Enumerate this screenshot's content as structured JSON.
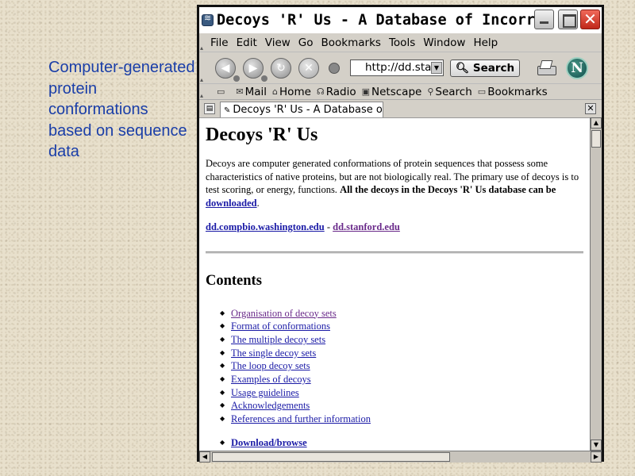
{
  "caption": "Computer-generated protein conformations based on sequence data",
  "window": {
    "title": "Decoys 'R' Us - A Database of Incorrect Pr…",
    "close_symbol": "✕"
  },
  "menubar": [
    "File",
    "Edit",
    "View",
    "Go",
    "Bookmarks",
    "Tools",
    "Window",
    "Help"
  ],
  "navbar": {
    "url": "http://dd.stan",
    "search_label": "Search"
  },
  "personal_toolbar": [
    "Mail",
    "Home",
    "Radio",
    "Netscape",
    "Search",
    "Bookmarks"
  ],
  "tab": {
    "label": "Decoys 'R' Us - A Database o…"
  },
  "page": {
    "heading": "Decoys 'R' Us",
    "intro": "Decoys are computer generated conformations of protein sequences that possess some characteristics of native proteins, but are not biologically real. The primary use of decoys is to test scoring, or energy, functions.",
    "intro_bold": "All the decoys in the Decoys 'R' Us database can be",
    "download_link": "downloaded",
    "period": ".",
    "mirror_1": "dd.compbio.washington.edu",
    "mirror_sep": " - ",
    "mirror_2": "dd.stanford.edu",
    "contents_heading": "Contents",
    "contents": [
      "Organisation of decoy sets",
      "Format of conformations",
      "The multiple decoy sets",
      "The single decoy sets",
      "The loop decoy sets",
      "Examples of decoys",
      "Usage guidelines",
      "Acknowledgements",
      "References and further information"
    ],
    "download_browse": "Download/browse"
  },
  "colors": {
    "caption": "#1a3ea8",
    "link": "#1a1aa6",
    "visited_link": "#6a2a8a"
  }
}
